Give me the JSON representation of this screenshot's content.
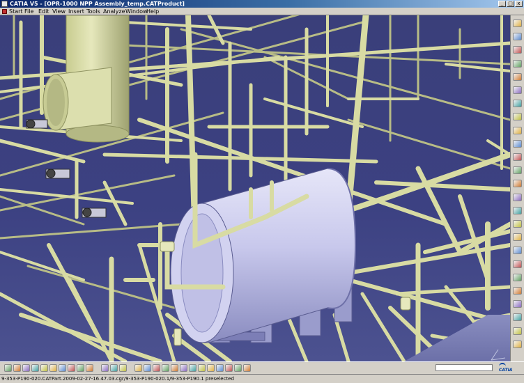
{
  "window": {
    "title": "CATIA V5 - [OPR-1000 NPP Assembly_temp.CATProduct]",
    "minimize_glyph": "_",
    "restore_glyph": "□",
    "close_glyph": "x"
  },
  "menu": {
    "items": [
      "Start",
      "File",
      "Edit",
      "View",
      "Insert",
      "Tools",
      "Analyze",
      "Window",
      "Help"
    ]
  },
  "status": {
    "text": "9-353-P190-020.CATPart.2009-02-27-16.47.03.cgr/9-353-P190-020.1/9-353-P190.1 preselected"
  },
  "logo": {
    "text": "CATIA"
  },
  "colors": {
    "viewport_background": "#3c4182",
    "pipe": "#d8dba3",
    "pipe_shadow": "#8e9260",
    "vessel": "#c6c6ea",
    "vessel_shadow": "#8688b8"
  },
  "icons": {
    "right_toolbar": [
      "select-arrow-icon",
      "sketcher-icon",
      "product-icon",
      "insert-component-icon",
      "existing-component-icon",
      "new-part-icon",
      "replace-component-icon",
      "graph-tree-icon",
      "generate-numbering-icon",
      "fast-multi-instantiation-icon",
      "manipulation-icon",
      "snap-icon",
      "explode-icon",
      "stop-manipulate-icon",
      "constraint-icon",
      "fix-component-icon",
      "clash-icon",
      "sectioning-icon",
      "distance-icon",
      "annotation-icon",
      "scene-icon",
      "catalog-icon",
      "lamp-icon",
      "material-icon",
      "measure-icon"
    ],
    "bottom_toolbar": [
      "new-icon",
      "open-icon",
      "save-icon",
      "print-icon",
      "cut-icon",
      "copy-icon",
      "paste-icon",
      "undo-icon",
      "redo-icon",
      "whats-this-icon",
      "fo-icon",
      "chat-icon",
      "catalog-browser-icon",
      "compass-icon",
      "fly-mode-icon",
      "fit-all-icon",
      "pan-icon",
      "rotate-icon",
      "zoom-in-icon",
      "zoom-out-icon",
      "normal-view-icon",
      "quick-view-icon",
      "multi-view-icon",
      "shading-icon",
      "hide-show-icon",
      "swap-space-icon"
    ]
  }
}
